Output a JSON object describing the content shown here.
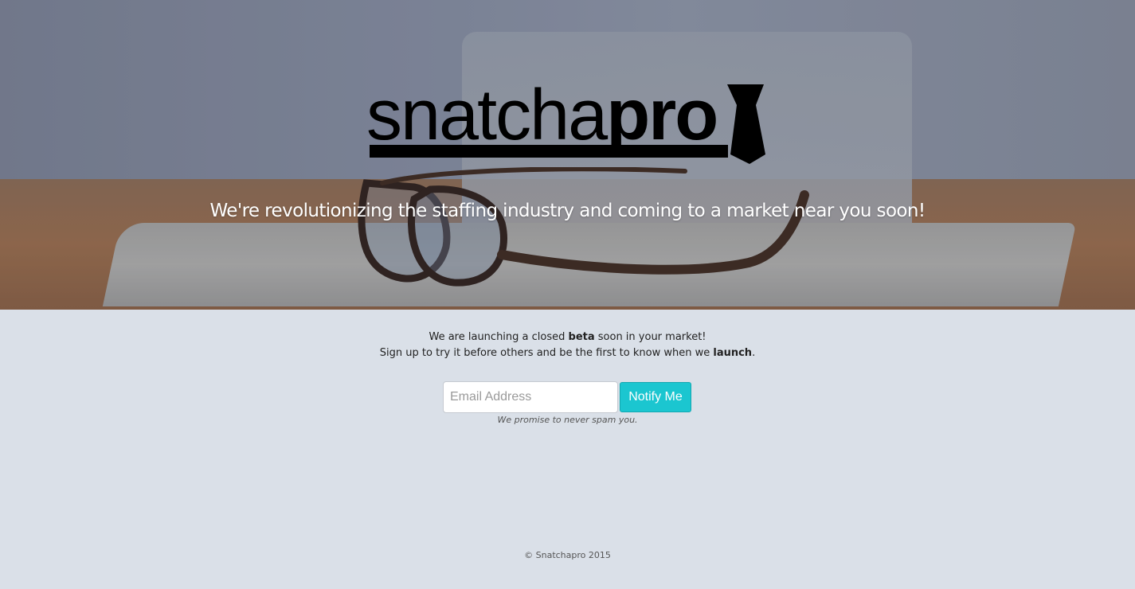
{
  "hero": {
    "logo": {
      "text_light": "snatcha",
      "text_bold": "pro",
      "icon": "necktie-icon"
    },
    "tagline": "We're revolutionizing the staffing industry and coming to a market near you soon!"
  },
  "intro": {
    "line1_before": "We are launching a closed ",
    "line1_bold": "beta",
    "line1_after": " soon in your market!",
    "line2_before": "Sign up to try it before others and be the first to know when we ",
    "line2_bold": "launch",
    "line2_after": "."
  },
  "signup": {
    "email_placeholder": "Email Address",
    "email_value": "",
    "button_label": "Notify Me",
    "disclaimer": "We promise to never spam you."
  },
  "footer": {
    "copyright": "© Snatchapro 2015"
  },
  "colors": {
    "page_background": "#dae0e8",
    "button_accent": "#1bc6d0",
    "tagline_text": "#ffffff"
  }
}
